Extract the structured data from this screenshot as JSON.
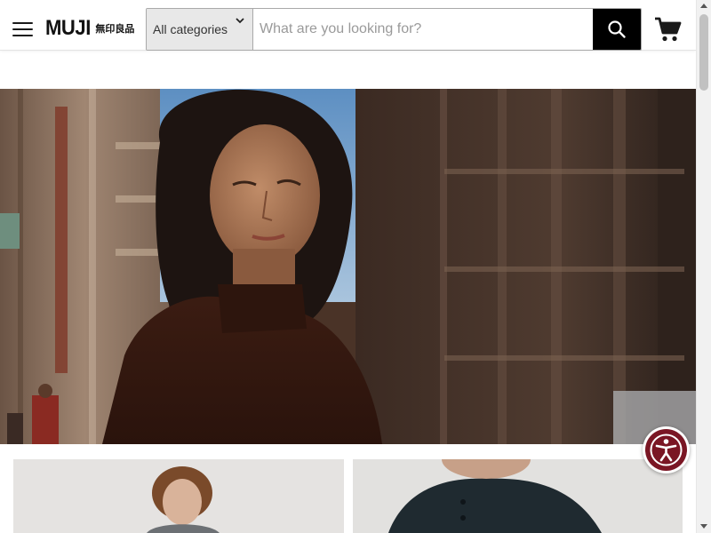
{
  "header": {
    "logo": {
      "latin": "MUJI",
      "japanese": "無印良品"
    },
    "search": {
      "category_selected": "All categories",
      "placeholder": "What are you looking for?",
      "value": ""
    }
  },
  "icons": {
    "menu": "hamburger-menu-icon",
    "category_dropdown": "chevron-down-icon",
    "search": "search-icon",
    "cart": "shopping-cart-icon",
    "accessibility": "accessibility-person-icon"
  },
  "colors": {
    "search_button": "#000000",
    "accessibility_button": "#7a1624",
    "category_background": "#e8e8e8"
  }
}
